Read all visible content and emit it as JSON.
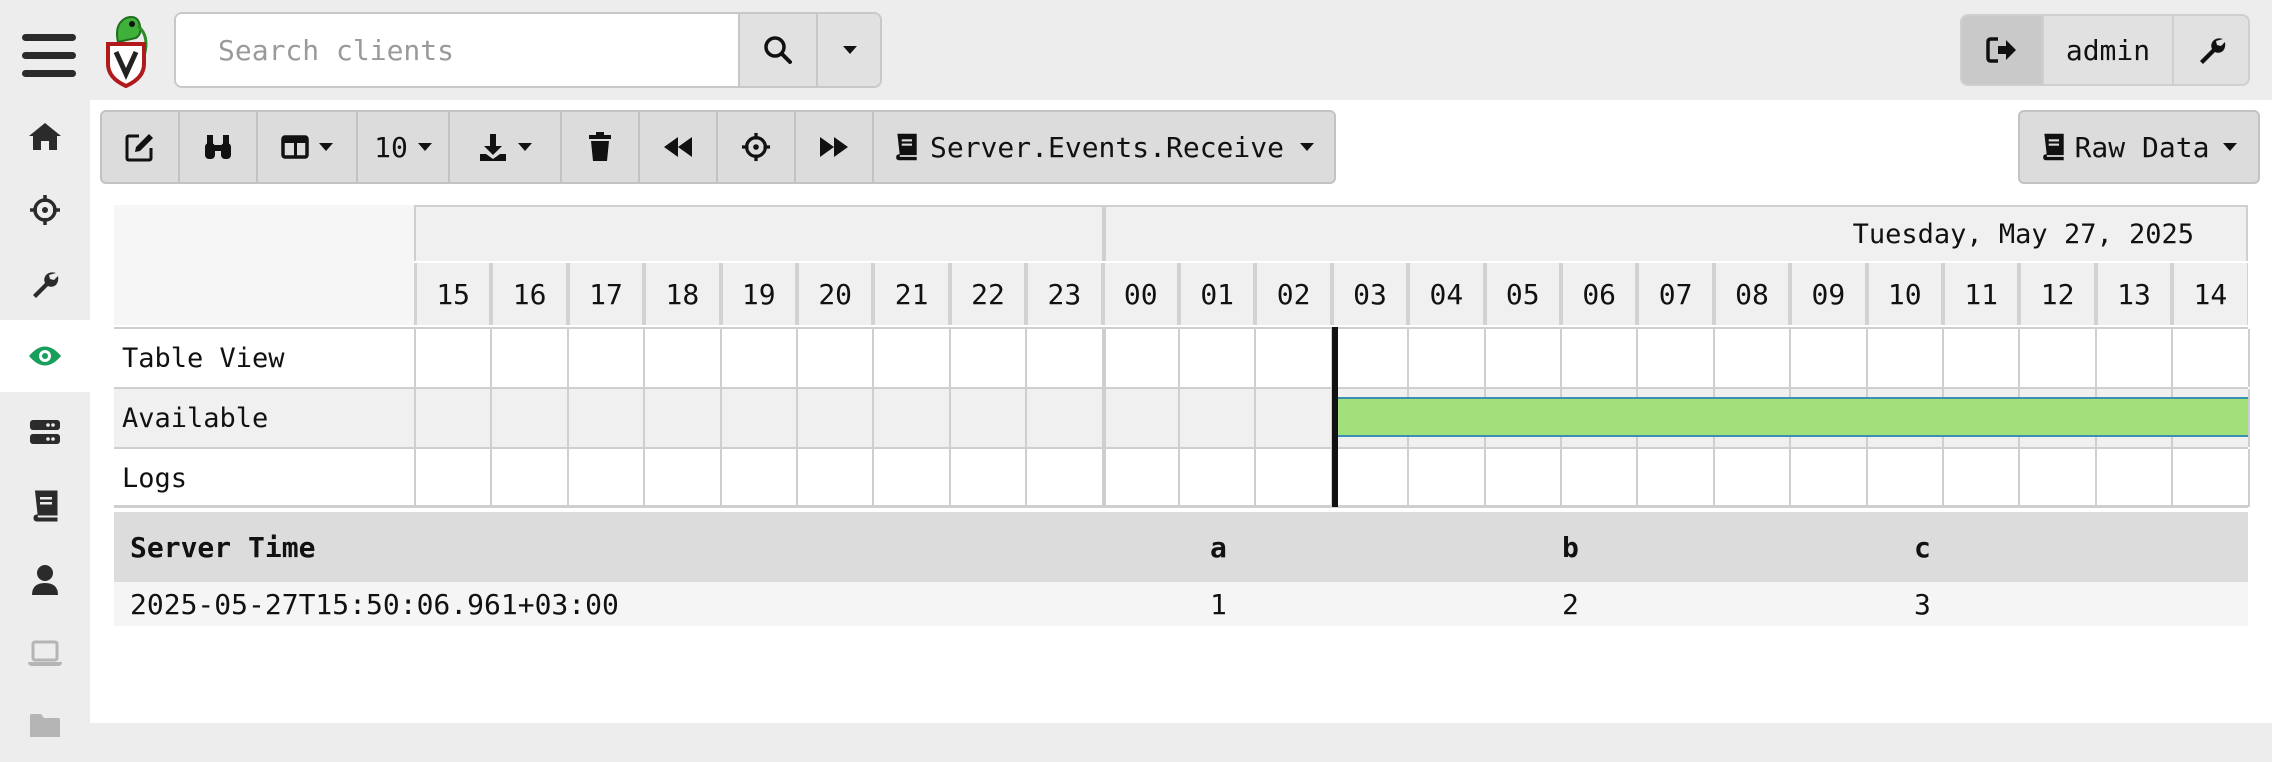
{
  "search": {
    "placeholder": "Search clients"
  },
  "user": {
    "name": "admin"
  },
  "sidebar": {
    "items": [
      {
        "icon": "home-icon"
      },
      {
        "icon": "crosshair-icon"
      },
      {
        "icon": "wrench-icon"
      },
      {
        "icon": "eye-icon",
        "active": true
      },
      {
        "icon": "server-icon"
      },
      {
        "icon": "book-icon"
      },
      {
        "icon": "user-icon"
      },
      {
        "icon": "laptop-icon"
      },
      {
        "icon": "folder-icon"
      }
    ]
  },
  "toolbar": {
    "page_size": "10",
    "artifact": "Server.Events.Receive",
    "view_mode": "Raw Data"
  },
  "timeline": {
    "date": "Tuesday, May 27, 2025",
    "hours": [
      "15",
      "16",
      "17",
      "18",
      "19",
      "20",
      "21",
      "22",
      "23",
      "00",
      "01",
      "02",
      "03",
      "04",
      "05",
      "06",
      "07",
      "08",
      "09",
      "10",
      "11",
      "12",
      "13",
      "14"
    ],
    "rows": [
      "Table View",
      "Available",
      "Logs"
    ]
  },
  "table": {
    "columns": [
      "Server Time",
      "a",
      "b",
      "c"
    ],
    "rows": [
      [
        "2025-05-27T15:50:06.961+03:00",
        "1",
        "2",
        "3"
      ]
    ]
  },
  "colors": {
    "accent": "#1a9e5b",
    "available_bar": "#a2e07b",
    "available_border": "#3b8fb3"
  }
}
